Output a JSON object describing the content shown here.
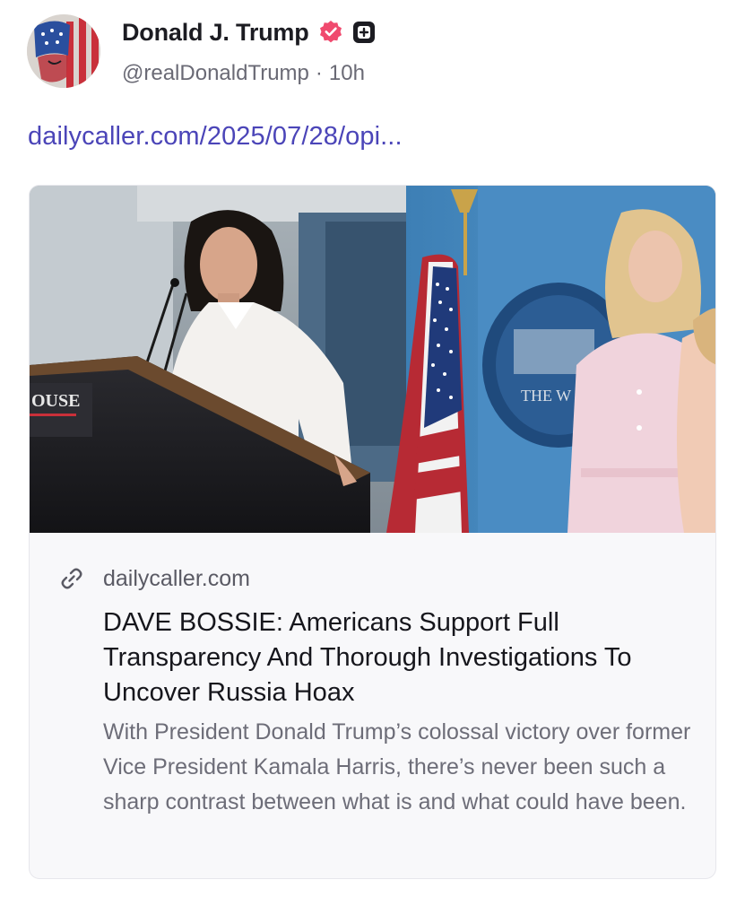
{
  "post": {
    "author": {
      "display_name": "Donald J. Trump",
      "handle": "@realDonaldTrump",
      "separator": "·",
      "time": "10h",
      "verified": true,
      "avatar_icon": "flag-face-avatar",
      "badge_icon": "plus-square-icon"
    },
    "link_text": "dailycaller.com/2025/07/28/opi...",
    "card": {
      "image_icon": "press-briefing-photo",
      "podium_text": "OUSE",
      "seal_text": "THE W",
      "domain": "dailycaller.com",
      "domain_icon": "link-icon",
      "headline": "DAVE BOSSIE: Americans Support Full Transparency And Thorough Investigations To Uncover Russia Hoax",
      "description": "With President Donald Trump’s colossal victory over former Vice President Kamala Harris, there’s never been such a sharp contrast between what is and what could have been."
    }
  },
  "colors": {
    "link": "#4b45b8",
    "verified": "#f04a6e",
    "text_primary": "#1c1c22",
    "text_secondary": "#6a6a75",
    "card_bg": "#f8f8fa"
  }
}
